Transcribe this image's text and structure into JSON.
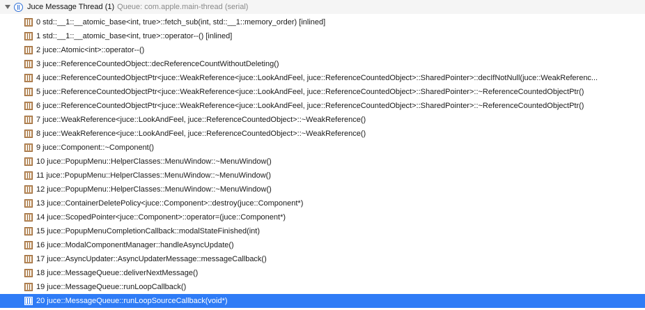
{
  "thread": {
    "title": "Juce Message Thread (1)",
    "queue": "Queue: com.apple.main-thread (serial)"
  },
  "frames": [
    "0 std::__1::__atomic_base<int, true>::fetch_sub(int, std::__1::memory_order) [inlined]",
    "1 std::__1::__atomic_base<int, true>::operator--() [inlined]",
    "2 juce::Atomic<int>::operator--()",
    "3 juce::ReferenceCountedObject::decReferenceCountWithoutDeleting()",
    "4 juce::ReferenceCountedObjectPtr<juce::WeakReference<juce::LookAndFeel, juce::ReferenceCountedObject>::SharedPointer>::decIfNotNull(juce::WeakReferenc...",
    "5 juce::ReferenceCountedObjectPtr<juce::WeakReference<juce::LookAndFeel, juce::ReferenceCountedObject>::SharedPointer>::~ReferenceCountedObjectPtr()",
    "6 juce::ReferenceCountedObjectPtr<juce::WeakReference<juce::LookAndFeel, juce::ReferenceCountedObject>::SharedPointer>::~ReferenceCountedObjectPtr()",
    "7 juce::WeakReference<juce::LookAndFeel, juce::ReferenceCountedObject>::~WeakReference()",
    "8 juce::WeakReference<juce::LookAndFeel, juce::ReferenceCountedObject>::~WeakReference()",
    "9 juce::Component::~Component()",
    "10 juce::PopupMenu::HelperClasses::MenuWindow::~MenuWindow()",
    "11 juce::PopupMenu::HelperClasses::MenuWindow::~MenuWindow()",
    "12 juce::PopupMenu::HelperClasses::MenuWindow::~MenuWindow()",
    "13 juce::ContainerDeletePolicy<juce::Component>::destroy(juce::Component*)",
    "14 juce::ScopedPointer<juce::Component>::operator=(juce::Component*)",
    "15 juce::PopupMenuCompletionCallback::modalStateFinished(int)",
    "16 juce::ModalComponentManager::handleAsyncUpdate()",
    "17 juce::AsyncUpdater::AsyncUpdaterMessage::messageCallback()",
    "18 juce::MessageQueue::deliverNextMessage()",
    "19 juce::MessageQueue::runLoopCallback()",
    "20 juce::MessageQueue::runLoopSourceCallback(void*)"
  ],
  "selected_frame": 20,
  "colors": {
    "selection": "#2f7cf6",
    "thread_icon": "#2f6fd6",
    "frame_icon": "#c8996a"
  },
  "icons": {
    "disclosure": "disclosure-triangle-icon",
    "thread": "thread-icon",
    "frame": "stack-frame-icon"
  }
}
